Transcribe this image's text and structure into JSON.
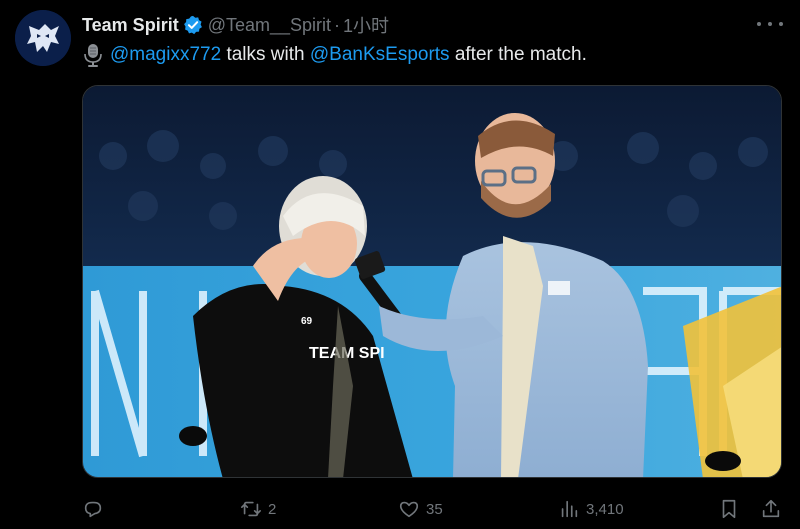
{
  "tweet": {
    "author_name": "Team Spirit",
    "author_handle": "@Team__Spirit",
    "separator": "·",
    "timestamp": "1小时",
    "text_parts": {
      "mention1": "@magixx772",
      "middle": " talks with ",
      "mention2": "@BanKsEsports",
      "end": " after the match."
    },
    "media_overlay_text": "TEAM SPI",
    "media_jersey_number": "69"
  },
  "actions": {
    "reply_count": "",
    "retweet_count": "2",
    "like_count": "35",
    "views_count": "3,410"
  },
  "icons": {
    "avatar": "team-spirit-dragon-logo",
    "verified": "verified-badge-icon",
    "more": "more-options-icon",
    "mic": "microphone-icon",
    "reply": "reply-icon",
    "retweet": "retweet-icon",
    "like": "heart-icon",
    "views": "views-bar-chart-icon",
    "bookmark": "bookmark-icon",
    "share": "share-icon"
  },
  "colors": {
    "background": "#000000",
    "text_primary": "#e7e9ea",
    "text_secondary": "#71767b",
    "link": "#1d9bf0",
    "verified": "#1d9bf0"
  }
}
